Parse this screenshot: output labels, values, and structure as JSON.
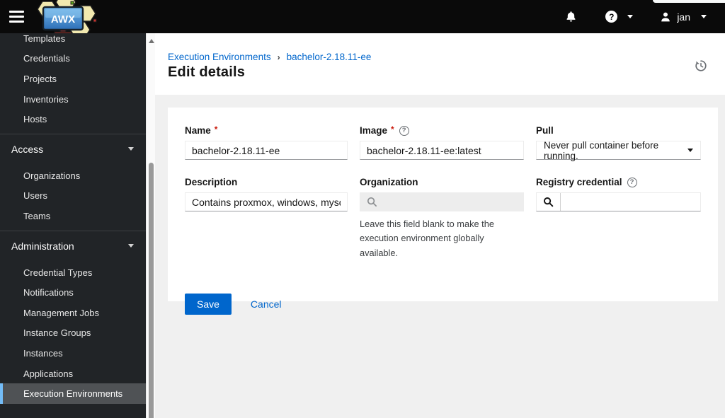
{
  "icons": {
    "question_mark": "?",
    "required_asterisk": "*",
    "breadcrumb_separator": "›"
  },
  "colors": {
    "masthead_bg": "#0a0a0a",
    "sidebar_bg": "#212427",
    "sidebar_selected_bg": "#4f5255",
    "sidebar_selected_border": "#73bcf7",
    "content_bg": "#f0f0f0",
    "card_bg": "#ffffff",
    "accent_blue": "#0066cc",
    "required_red": "#c9190b"
  },
  "masthead": {
    "logo_text": "AWX",
    "user_name": "jan"
  },
  "sidebar": {
    "top_items": [
      "Templates",
      "Credentials",
      "Projects",
      "Inventories",
      "Hosts"
    ],
    "groups": [
      {
        "label": "Access",
        "items": [
          "Organizations",
          "Users",
          "Teams"
        ]
      },
      {
        "label": "Administration",
        "items": [
          "Credential Types",
          "Notifications",
          "Management Jobs",
          "Instance Groups",
          "Instances",
          "Applications",
          "Execution Environments"
        ]
      }
    ],
    "selected_item": "Execution Environments"
  },
  "breadcrumb": {
    "links": [
      "Execution Environments",
      "bachelor-2.18.11-ee"
    ]
  },
  "page": {
    "title": "Edit details"
  },
  "form": {
    "fields": {
      "name": {
        "label": "Name",
        "value": "bachelor-2.18.11-ee"
      },
      "image": {
        "label": "Image",
        "value": "bachelor-2.18.11-ee:latest"
      },
      "pull": {
        "label": "Pull",
        "selected_option": "Never pull container before running."
      },
      "description": {
        "label": "Description",
        "value": "Contains proxmox, windows, mysql, za..."
      },
      "organization": {
        "label": "Organization",
        "value": "",
        "helper_text": "Leave this field blank to make the execution environment globally available."
      },
      "registry_credential": {
        "label": "Registry credential",
        "value": ""
      }
    },
    "actions": {
      "save_label": "Save",
      "cancel_label": "Cancel"
    }
  }
}
